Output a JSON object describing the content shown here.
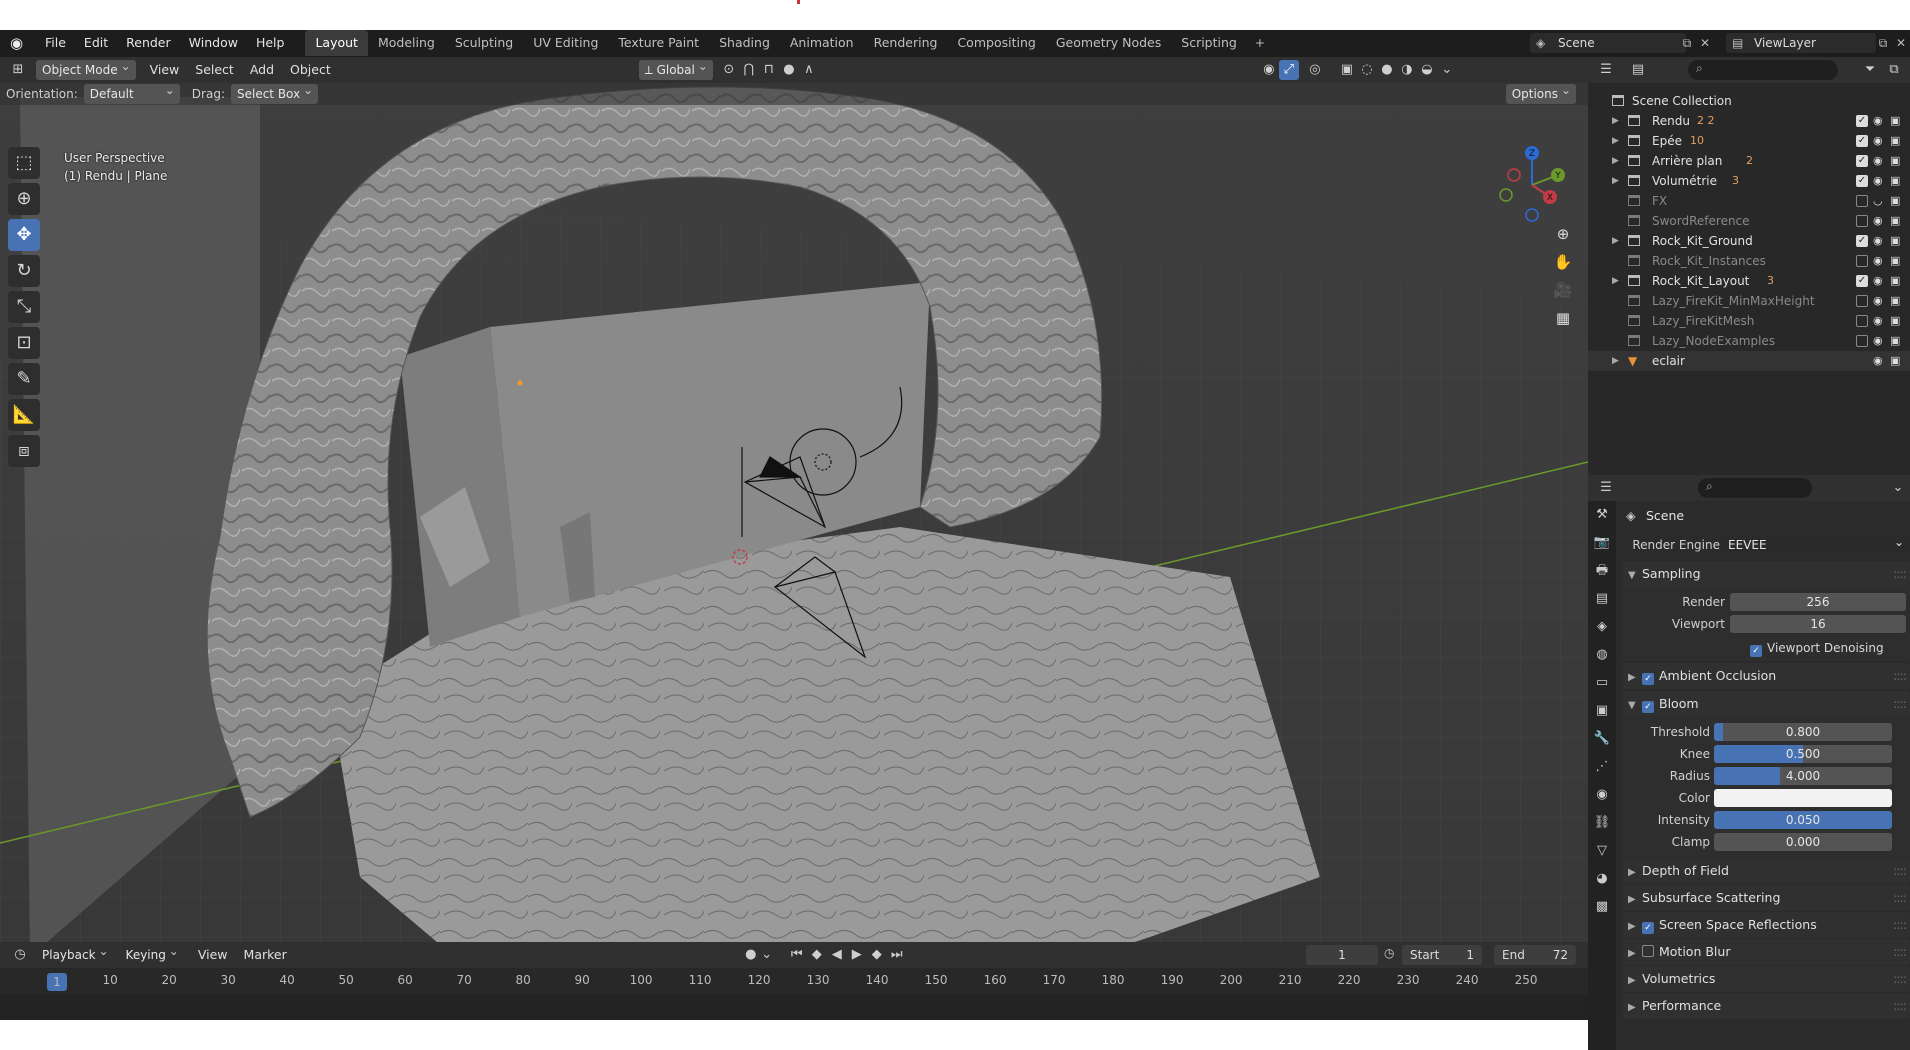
{
  "menubar": {
    "items": [
      "File",
      "Edit",
      "Render",
      "Window",
      "Help"
    ],
    "workspaces": [
      "Layout",
      "Modeling",
      "Sculpting",
      "UV Editing",
      "Texture Paint",
      "Shading",
      "Animation",
      "Rendering",
      "Compositing",
      "Geometry Nodes",
      "Scripting"
    ],
    "active_workspace": "Layout",
    "scene": "Scene",
    "view_layer": "ViewLayer"
  },
  "viewport": {
    "mode": "Object Mode",
    "menus": [
      "View",
      "Select",
      "Add",
      "Object"
    ],
    "transform_orientation": "Global",
    "orientation_label": "Orientation:",
    "orientation_value": "Default",
    "drag_label": "Drag:",
    "drag_value": "Select Box",
    "options_label": "Options",
    "info_line1": "User Perspective",
    "info_line2": "(1) Rendu | Plane",
    "gizmo": {
      "z": "Z",
      "y": "Y",
      "x": "X"
    }
  },
  "timeline": {
    "menus": [
      "Playback",
      "Keying",
      "View",
      "Marker"
    ],
    "current_frame": "1",
    "start_label": "Start",
    "start": "1",
    "end_label": "End",
    "end": "72",
    "ruler": [
      "1",
      "10",
      "20",
      "30",
      "40",
      "50",
      "60",
      "70",
      "80",
      "90",
      "100",
      "110",
      "120",
      "130",
      "140",
      "150",
      "160",
      "170",
      "180",
      "190",
      "200",
      "210",
      "220",
      "230",
      "240",
      "250"
    ]
  },
  "outliner": {
    "root": "Scene Collection",
    "items": [
      {
        "name": "Rendu",
        "extra": "2  2",
        "arrow": true,
        "dim": false,
        "checked": true
      },
      {
        "name": "Epée",
        "extra": "10",
        "arrow": true,
        "dim": false,
        "checked": true
      },
      {
        "name": "Arrière plan",
        "extra": "2",
        "arrow": true,
        "dim": false,
        "checked": true
      },
      {
        "name": "Volumétrie",
        "extra": "3",
        "arrow": true,
        "dim": false,
        "checked": true
      },
      {
        "name": "FX",
        "extra": "",
        "arrow": false,
        "dim": true,
        "checked": false
      },
      {
        "name": "SwordReference",
        "extra": "",
        "arrow": false,
        "dim": true,
        "checked": false
      },
      {
        "name": "Rock_Kit_Ground",
        "extra": "",
        "arrow": true,
        "dim": false,
        "checked": true
      },
      {
        "name": "Rock_Kit_Instances",
        "extra": "",
        "arrow": false,
        "dim": true,
        "checked": false
      },
      {
        "name": "Rock_Kit_Layout",
        "extra": "3",
        "arrow": true,
        "dim": false,
        "checked": true
      },
      {
        "name": "Lazy_FireKit_MinMaxHeight",
        "extra": "",
        "arrow": false,
        "dim": true,
        "checked": false
      },
      {
        "name": "Lazy_FireKitMesh",
        "extra": "",
        "arrow": false,
        "dim": true,
        "checked": false
      },
      {
        "name": "Lazy_NodeExamples",
        "extra": "",
        "arrow": false,
        "dim": true,
        "checked": false
      },
      {
        "name": "eclair",
        "extra": "",
        "arrow": true,
        "dim": false,
        "checked": null
      }
    ]
  },
  "properties": {
    "title": "Scene",
    "render_engine_label": "Render Engine",
    "render_engine": "EEVEE",
    "sampling": {
      "label": "Sampling",
      "render_label": "Render",
      "render": "256",
      "viewport_label": "Viewport",
      "viewport": "16",
      "denoise_label": "Viewport Denoising"
    },
    "ambient_occlusion": "Ambient Occlusion",
    "bloom": {
      "label": "Bloom",
      "threshold_label": "Threshold",
      "threshold": "0.800",
      "threshold_fill": 0.05,
      "knee_label": "Knee",
      "knee": "0.500",
      "knee_fill": 0.5,
      "radius_label": "Radius",
      "radius": "4.000",
      "radius_fill": 0.37,
      "color_label": "Color",
      "intensity_label": "Intensity",
      "intensity": "0.050",
      "intensity_fill": 1.0,
      "clamp_label": "Clamp",
      "clamp": "0.000"
    },
    "panels": [
      {
        "label": "Depth of Field",
        "checkbox": null
      },
      {
        "label": "Subsurface Scattering",
        "checkbox": null
      },
      {
        "label": "Screen Space Reflections",
        "checkbox": true
      },
      {
        "label": "Motion Blur",
        "checkbox": false
      },
      {
        "label": "Volumetrics",
        "checkbox": null
      },
      {
        "label": "Performance",
        "checkbox": null
      }
    ]
  },
  "colors": {
    "accent": "#4772b3",
    "background": "#3d3d3d",
    "panel": "#2b2b2b",
    "x_axis": "#c43b48",
    "y_axis": "#6a9a2a"
  }
}
